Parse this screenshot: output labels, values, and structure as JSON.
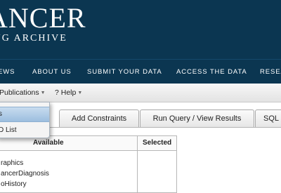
{
  "banner": {
    "logo_main": "ANCER",
    "logo_sub": "ING ARCHIVE",
    "background": "#0b3651"
  },
  "nav": {
    "items": [
      {
        "label": "EWS"
      },
      {
        "label": "ABOUT US"
      },
      {
        "label": "SUBMIT YOUR DATA"
      },
      {
        "label": "ACCESS THE DATA"
      },
      {
        "label": "RESEA"
      }
    ]
  },
  "menubar": {
    "publications_label": "Publications",
    "help_label": "? Help"
  },
  "dropdown": {
    "items": [
      {
        "label": "s"
      },
      {
        "label": "D List"
      }
    ]
  },
  "tabs": [
    {
      "label": "Add Constraints"
    },
    {
      "label": "Run Query / View Results"
    },
    {
      "label": "SQL"
    }
  ],
  "panel": {
    "available_header": "Available",
    "selected_header": "Selected",
    "items": [
      "raphics",
      "ancerDiagnosis",
      "oHistory"
    ]
  }
}
